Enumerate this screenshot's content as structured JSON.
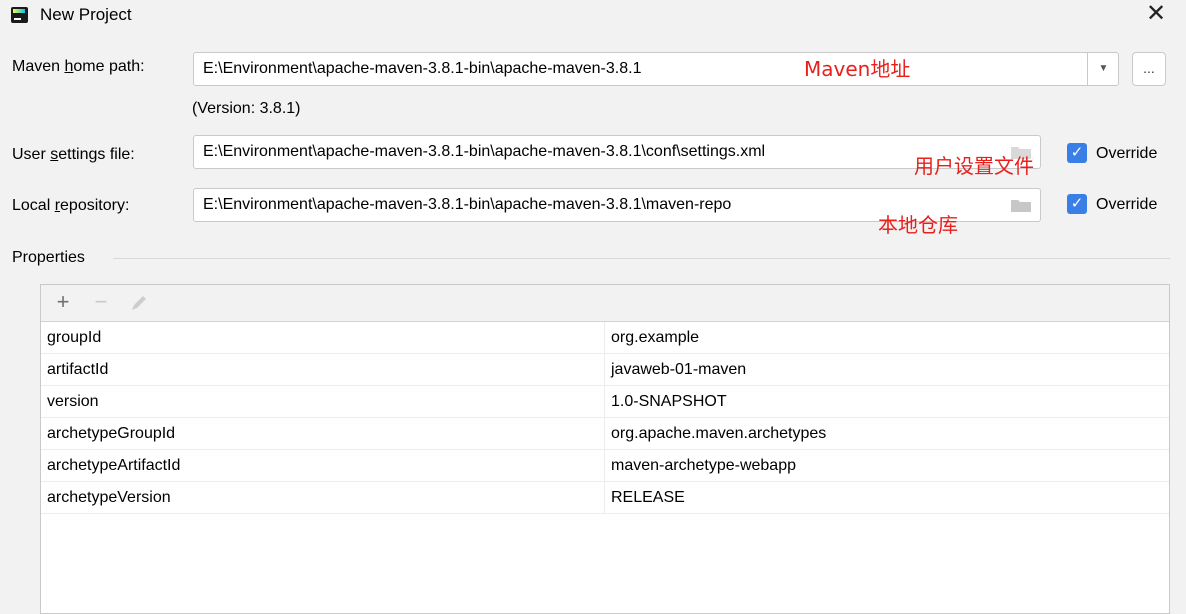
{
  "window": {
    "title": "New Project",
    "close_glyph": "✕"
  },
  "form": {
    "maven_home": {
      "label_pre": "Maven ",
      "label_mnemonic": "h",
      "label_post": "ome path:",
      "value": "E:\\Environment\\apache-maven-3.8.1-bin\\apache-maven-3.8.1",
      "version": "(Version: 3.8.1)",
      "browse_label": "..."
    },
    "user_settings": {
      "label_pre": "User ",
      "label_mnemonic": "s",
      "label_post": "ettings file:",
      "value": "E:\\Environment\\apache-maven-3.8.1-bin\\apache-maven-3.8.1\\conf\\settings.xml",
      "override_label": "Override",
      "override_checked": true
    },
    "local_repo": {
      "label_pre": "Local ",
      "label_mnemonic": "r",
      "label_post": "epository:",
      "value": "E:\\Environment\\apache-maven-3.8.1-bin\\apache-maven-3.8.1\\maven-repo",
      "override_label": "Override",
      "override_checked": true
    }
  },
  "annotations": {
    "maven_address": "Maven地址",
    "user_settings": "用户设置文件",
    "local_repo": "本地仓库"
  },
  "properties": {
    "section_title": "Properties",
    "toolbar": {
      "add": "+",
      "remove": "−"
    },
    "rows": [
      {
        "key": "groupId",
        "value": "org.example"
      },
      {
        "key": "artifactId",
        "value": "javaweb-01-maven"
      },
      {
        "key": "version",
        "value": "1.0-SNAPSHOT"
      },
      {
        "key": "archetypeGroupId",
        "value": "org.apache.maven.archetypes"
      },
      {
        "key": "archetypeArtifactId",
        "value": "maven-archetype-webapp"
      },
      {
        "key": "archetypeVersion",
        "value": "RELEASE"
      }
    ]
  },
  "colors": {
    "accent": "#3a7ee8",
    "annotation": "#e8201c",
    "background": "#f2f2f2"
  }
}
